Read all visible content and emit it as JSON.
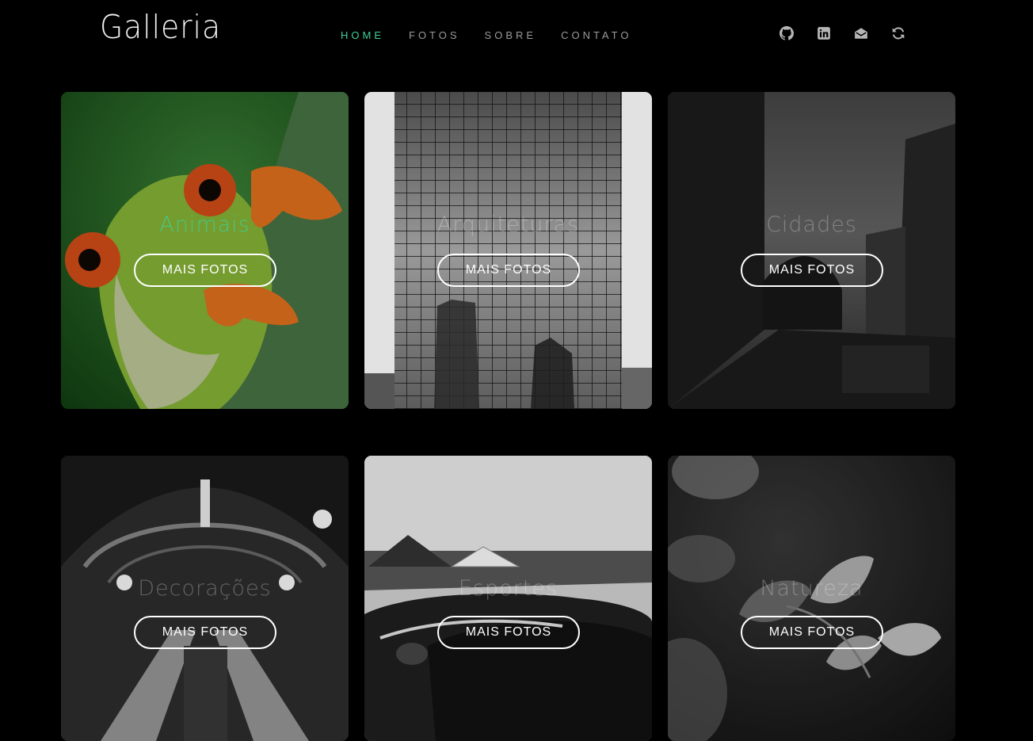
{
  "brand": {
    "logo": "Galleria"
  },
  "nav": {
    "items": [
      "HOME",
      "FOTOS",
      "SOBRE",
      "CONTATO"
    ],
    "active": "HOME",
    "accent_color": "#3fd19b"
  },
  "social_icons": [
    "github-icon",
    "linkedin-icon",
    "mail-open-icon",
    "refresh-icon"
  ],
  "gallery": {
    "cards": [
      {
        "category": "Animais",
        "button": "MAIS FOTOS"
      },
      {
        "category": "Arquiteturas",
        "button": "MAIS FOTOS"
      },
      {
        "category": "Cidades",
        "button": "MAIS FOTOS"
      },
      {
        "category": "Decorações",
        "button": "MAIS FOTOS"
      },
      {
        "category": "Esportes",
        "button": "MAIS FOTOS"
      },
      {
        "category": "Natureza",
        "button": "MAIS FOTOS"
      }
    ]
  }
}
